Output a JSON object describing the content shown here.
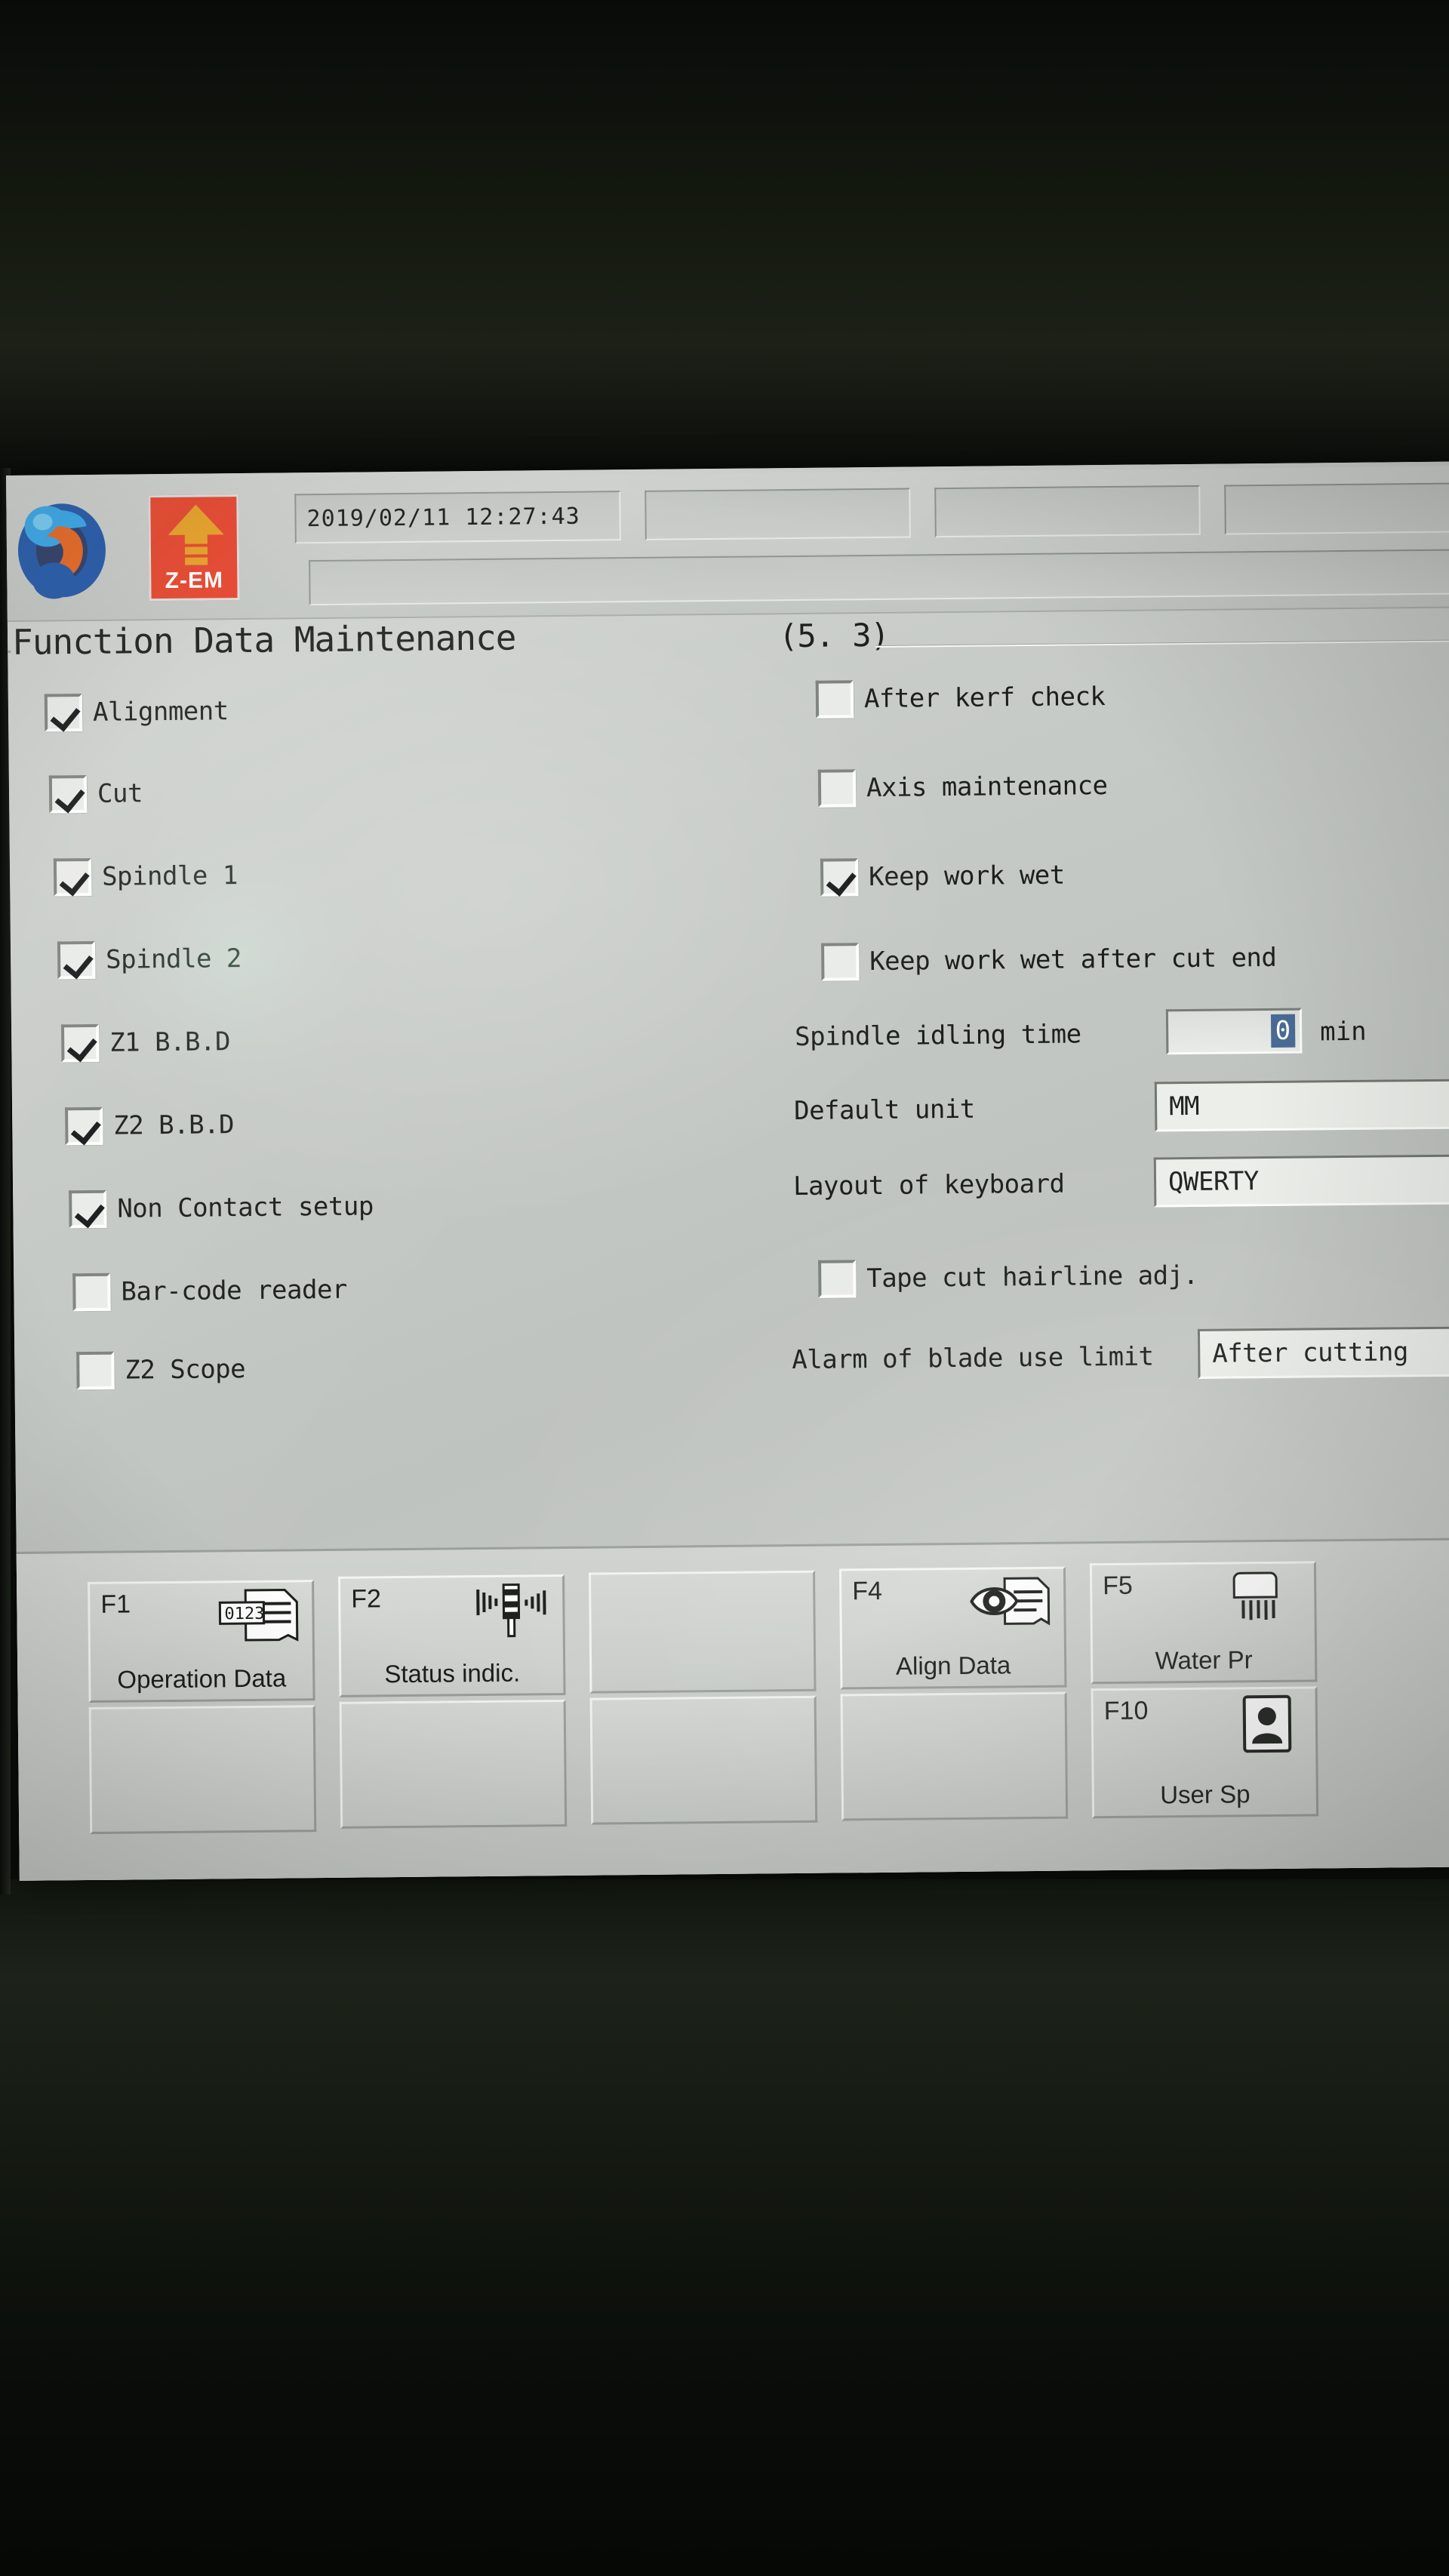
{
  "header": {
    "logo_icon": "zem-sphere-logo",
    "zem_button_label": "Z-EM",
    "zem_arrow_icon": "up-arrow-icon",
    "datetime": "2019/02/11 12:27:43",
    "status_box_2": "",
    "status_box_3": "",
    "status_box_4": "",
    "message_bar": ""
  },
  "groupbox": {
    "title": "Function Data Maintenance",
    "section_number": "(5. 3)"
  },
  "left_column": {
    "checkboxes": [
      {
        "label": "Alignment",
        "checked": true
      },
      {
        "label": "Cut",
        "checked": true
      },
      {
        "label": "Spindle 1",
        "checked": true
      },
      {
        "label": "Spindle 2",
        "checked": true
      },
      {
        "label": "Z1 B.B.D",
        "checked": true
      },
      {
        "label": "Z2 B.B.D",
        "checked": true
      },
      {
        "label": "Non Contact setup",
        "checked": true
      },
      {
        "label": "Bar-code reader",
        "checked": false
      },
      {
        "label": "Z2 Scope",
        "checked": false
      }
    ]
  },
  "right_column": {
    "checkboxes": [
      {
        "label": "After kerf check",
        "checked": false
      },
      {
        "label": "Axis maintenance",
        "checked": false
      },
      {
        "label": "Keep work wet",
        "checked": true
      },
      {
        "label": "Keep work wet after cut end",
        "checked": false
      }
    ],
    "spindle_idling_time": {
      "label": "Spindle idling time",
      "value": "0",
      "unit": "min"
    },
    "default_unit": {
      "label": "Default unit",
      "value": "MM"
    },
    "keyboard_layout": {
      "label": "Layout of keyboard",
      "value": "QWERTY"
    },
    "tape_cut_hairline": {
      "label": "Tape cut hairline adj.",
      "checked": false
    },
    "blade_use_limit_alarm": {
      "label": "Alarm of blade use limit",
      "value": "After cutting"
    }
  },
  "function_keys": [
    {
      "key": "F1",
      "label": "Operation Data",
      "icon": "numbered-document-icon",
      "icon_text": "0123"
    },
    {
      "key": "F2",
      "label": "Status indic.",
      "icon": "signal-tower-icon",
      "icon_text": ""
    },
    {
      "key": "",
      "label": "",
      "icon": "",
      "icon_text": ""
    },
    {
      "key": "F4",
      "label": "Align Data",
      "icon": "eye-document-icon",
      "icon_text": ""
    },
    {
      "key": "F5",
      "label": "Water Pr",
      "icon": "water-shower-icon",
      "icon_text": ""
    },
    {
      "key": "F10",
      "label": "User Sp",
      "icon": "user-card-icon",
      "icon_text": ""
    }
  ],
  "colors": {
    "zem_button_background": "#e8432a",
    "zem_arrow": "#e8a023",
    "screen_background": "#c9ccc9",
    "text": "#1c1f1c",
    "selection_highlight": "#4a6b94",
    "logo_blue": "#1f8fd6",
    "logo_dark_blue": "#274a86",
    "logo_orange": "#e8641e"
  }
}
